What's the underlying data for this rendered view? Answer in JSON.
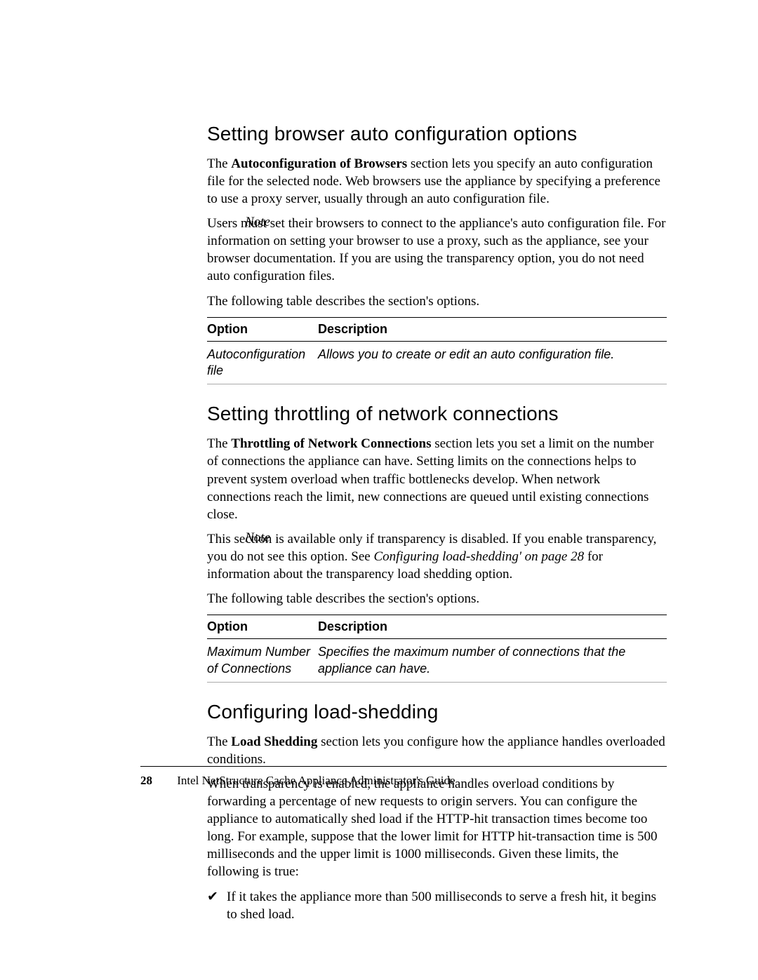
{
  "section1": {
    "heading": "Setting browser auto configuration options",
    "p1_pre": "The ",
    "p1_bold": "Autoconfiguration of Browsers",
    "p1_post": " section lets you specify an auto configuration file for the selected node. Web browsers use the appliance by specifying a preference to use a proxy server, usually through an auto configuration file.",
    "note_label": "Note",
    "note_text": "Users must set their browsers to connect to the appliance's auto configuration file. For information on setting your browser to use a proxy, such as the appliance, see your browser documentation. If you are using the transparency option, you do not need auto configuration files.",
    "lead": "The following table describes the section's options.",
    "table": {
      "head_option": "Option",
      "head_desc": "Description",
      "row1_opt": "Autoconfiguration file",
      "row1_desc": "Allows you to create or edit an auto configuration file."
    }
  },
  "section2": {
    "heading": "Setting throttling of network connections",
    "p1_pre": "The ",
    "p1_bold": "Throttling of Network Connections",
    "p1_post": " section lets you set a limit on the number of connections the appliance can have. Setting limits on the connections helps to prevent system overload when traffic bottlenecks develop. When network connections reach the limit, new connections are queued until existing connections close.",
    "note_label": "Note",
    "note_text_pre": "This section is available only if transparency is disabled. If you enable transparency, you do not see this option. See ",
    "note_text_ital": "Configuring load-shedding' on page 28",
    "note_text_post": " for information about the transparency load shedding option.",
    "lead": "The following table describes the section's options.",
    "table": {
      "head_option": "Option",
      "head_desc": "Description",
      "row1_opt": "Maximum Number of Connections",
      "row1_desc": "Specifies the maximum number of connections that the appliance can have."
    }
  },
  "section3": {
    "heading": "Configuring load-shedding",
    "p1_pre": "The ",
    "p1_bold": "Load Shedding",
    "p1_post": " section lets you configure how the appliance handles overloaded conditions.",
    "p2": "When transparency is enabled, the appliance handles overload conditions by forwarding a percentage of new requests to origin servers. You can configure the appliance to automatically shed load if the HTTP-hit transaction times become too long. For example, suppose that the lower limit for HTTP hit-transaction time is 500 milliseconds and the upper limit is 1000 milliseconds. Given these limits, the following is true:",
    "bullet1": "If it takes the appliance more than 500 milliseconds to serve a fresh hit, it begins to shed load."
  },
  "footer": {
    "page_number": "28",
    "title": "Intel NetStructure Cache Appliance Administrator's Guide"
  }
}
